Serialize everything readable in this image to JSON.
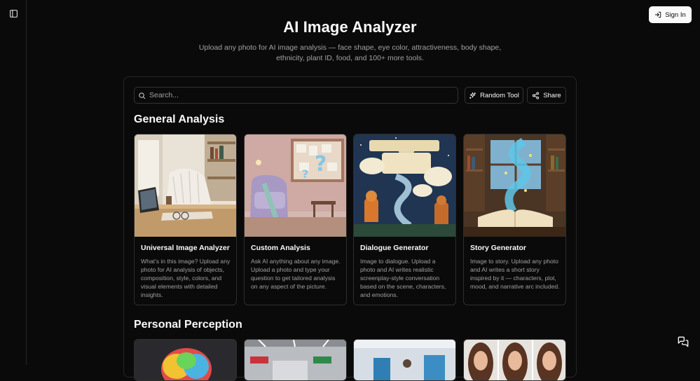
{
  "header": {
    "sign_in_label": "Sign In",
    "title": "AI Image Analyzer",
    "subtitle": "Upload any photo for AI image analysis — face shape, eye color, attractiveness, body shape, ethnicity, plant ID, food, and 100+ more tools."
  },
  "toolbar": {
    "search_placeholder": "Search...",
    "random_label": "Random Tool",
    "share_label": "Share"
  },
  "sections": [
    {
      "title": "General Analysis",
      "cards": [
        {
          "title": "Universal Image Analyzer",
          "description": "What's in this image? Upload any photo for AI analysis of objects, composition, style, colors, and visual elements with detailed insights."
        },
        {
          "title": "Custom Analysis",
          "description": "Ask AI anything about any image. Upload a photo and type your question to get tailored analysis on any aspect of the picture."
        },
        {
          "title": "Dialogue Generator",
          "description": "Image to dialogue. Upload a photo and AI writes realistic screenplay-style conversation based on the scene, characters, and emotions."
        },
        {
          "title": "Story Generator",
          "description": "Image to story. Upload any photo and AI writes a short story inspired by it — characters, plot, mood, and narrative arc included."
        }
      ]
    },
    {
      "title": "Personal Perception"
    }
  ],
  "icons": {
    "sidebar": "sidebar-toggle-icon",
    "sign_in": "log-in-icon",
    "search": "search-icon",
    "random": "sparkles-icon",
    "share": "share-icon",
    "chat": "messages-icon"
  }
}
